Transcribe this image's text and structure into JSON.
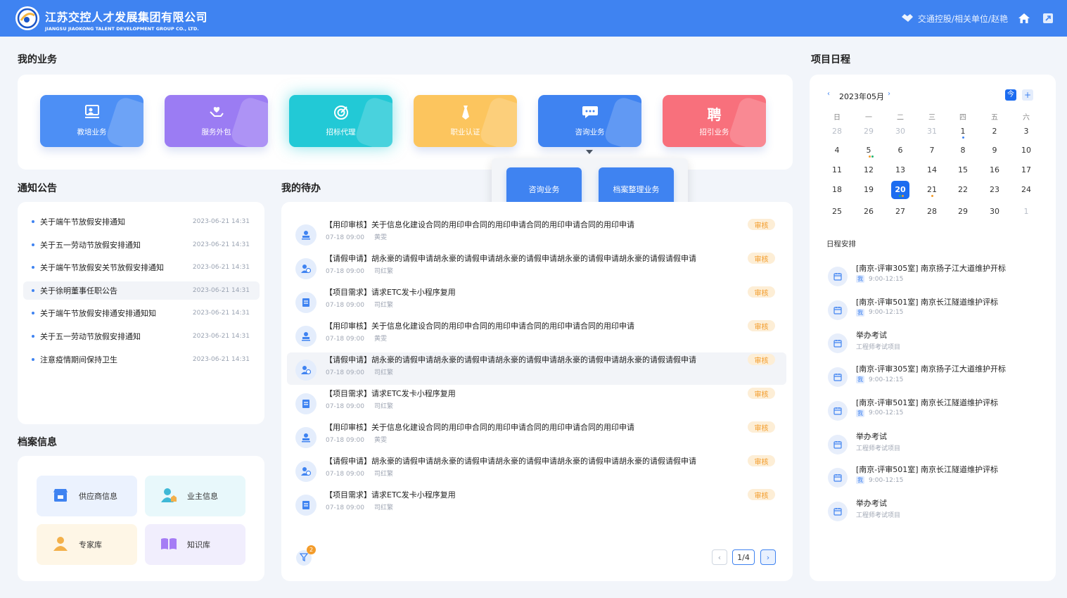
{
  "header": {
    "title_cn": "江苏交控人才发展集团有限公司",
    "title_en": "JIANGSU JIAOKONG TALENT DEVELOPMENT GROUP CO., LTD.",
    "user": "交通控股/相关单位/赵艳"
  },
  "sections": {
    "business": "我的业务",
    "notices": "通知公告",
    "todos": "我的待办",
    "archives": "档案信息",
    "schedule": "项目日程"
  },
  "business": [
    {
      "label": "教培业务",
      "color": "#4d8ff5",
      "icon": "training-icon"
    },
    {
      "label": "服务外包",
      "color": "#9b7cf3",
      "icon": "heart-hand-icon"
    },
    {
      "label": "招标代理",
      "color": "#22c9d6",
      "icon": "target-icon"
    },
    {
      "label": "职业认证",
      "color": "#fcc55e",
      "icon": "tie-icon"
    },
    {
      "label": "咨询业务",
      "color": "#3f83f1",
      "icon": "chat-icon"
    },
    {
      "label": "招引业务",
      "color": "#f8707c",
      "icon": "hire-icon",
      "glyph": "聘"
    }
  ],
  "submenu": [
    "咨询业务",
    "档案整理业务"
  ],
  "notices": [
    {
      "title": "关于端午节放假安排通知",
      "date": "2023-06-21 14:31"
    },
    {
      "title": "关于五一劳动节放假安排通知",
      "date": "2023-06-21 14:31"
    },
    {
      "title": "关于端午节放假安关节放假安排通知",
      "date": "2023-06-21 14:31"
    },
    {
      "title": "关于徐明董事任职公告",
      "date": "2023-06-21 14:31"
    },
    {
      "title": "关于端午节放假安排通安排通知知",
      "date": "2023-06-21 14:31"
    },
    {
      "title": "关于五一劳动节放假安排通知",
      "date": "2023-06-21 14:31"
    },
    {
      "title": "注意疫情期间保持卫生",
      "date": "2023-06-21 14:31"
    }
  ],
  "todos": [
    {
      "title": "【用印审核】关于信息化建设合同的用印申合同的用印申请合同的用印申请合同的用印申请",
      "time": "07-18 09:00",
      "person": "黄雯",
      "badge": "审核",
      "icon": "stamp-icon"
    },
    {
      "title": "【请假申请】胡永豪的请假申请胡永豪的请假申请胡永豪的请假申请胡永豪的请假申请胡永豪的请假请假申请",
      "time": "07-18 09:00",
      "person": "司红繁",
      "badge": "审核",
      "icon": "leave-icon"
    },
    {
      "title": "【项目需求】请求ETC发卡小程序复用",
      "time": "07-18 09:00",
      "person": "司红繁",
      "badge": "审核",
      "icon": "project-icon"
    },
    {
      "title": "【用印审核】关于信息化建设合同的用印申合同的用印申请合同的用印申请合同的用印申请",
      "time": "07-18 09:00",
      "person": "黄雯",
      "badge": "审核",
      "icon": "stamp-icon"
    },
    {
      "title": "【请假申请】胡永豪的请假申请胡永豪的请假申请胡永豪的请假申请胡永豪的请假申请胡永豪的请假请假申请",
      "time": "07-18 09:00",
      "person": "司红繁",
      "badge": "审核",
      "icon": "leave-icon"
    },
    {
      "title": "【项目需求】请求ETC发卡小程序复用",
      "time": "07-18 09:00",
      "person": "司红繁",
      "badge": "审核",
      "icon": "project-icon"
    },
    {
      "title": "【用印审核】关于信息化建设合同的用印申合同的用印申请合同的用印申请合同的用印申请",
      "time": "07-18 09:00",
      "person": "黄雯",
      "badge": "审核",
      "icon": "stamp-icon"
    },
    {
      "title": "【请假申请】胡永豪的请假申请胡永豪的请假申请胡永豪的请假申请胡永豪的请假申请胡永豪的请假请假申请",
      "time": "07-18 09:00",
      "person": "司红繁",
      "badge": "审核",
      "icon": "leave-icon"
    },
    {
      "title": "【项目需求】请求ETC发卡小程序复用",
      "time": "07-18 09:00",
      "person": "司红繁",
      "badge": "审核",
      "icon": "project-icon"
    }
  ],
  "filter_count": "2",
  "pagination": {
    "page": "1/4"
  },
  "archives": [
    {
      "label": "供应商信息",
      "bg": "#ebf2fe",
      "icon": "supplier-icon"
    },
    {
      "label": "业主信息",
      "bg": "#e8f8fb",
      "icon": "owner-icon"
    },
    {
      "label": "专家库",
      "bg": "#fef6e6",
      "icon": "expert-icon"
    },
    {
      "label": "知识库",
      "bg": "#f1eefd",
      "icon": "knowledge-icon"
    }
  ],
  "calendar": {
    "month": "2023年05月",
    "today_btn": "今",
    "add_btn": "+",
    "weekdays": [
      "日",
      "一",
      "二",
      "三",
      "四",
      "五",
      "六"
    ],
    "weeks": [
      [
        "28",
        "29",
        "30",
        "31",
        "1",
        "2",
        "3"
      ],
      [
        "4",
        "5",
        "6",
        "7",
        "8",
        "9",
        "10"
      ],
      [
        "11",
        "12",
        "13",
        "14",
        "15",
        "16",
        "17"
      ],
      [
        "18",
        "19",
        "20",
        "21",
        "22",
        "23",
        "24"
      ],
      [
        "25",
        "26",
        "27",
        "28",
        "29",
        "30",
        "1"
      ]
    ],
    "selected": "20"
  },
  "schedule_label": "日程安排",
  "schedule": [
    {
      "title": "[南京-评审305室] 南京扬子江大道维护开标",
      "tag": "我",
      "sub": "9:00-12:15"
    },
    {
      "title": "[南京-评审501室] 南京长江隧道维护评标",
      "tag": "我",
      "sub": "9:00-12:15"
    },
    {
      "title": "举办考试",
      "tag": "",
      "sub": "工程师考试项目"
    },
    {
      "title": "[南京-评审305室] 南京扬子江大道维护开标",
      "tag": "我",
      "sub": "9:00-12:15"
    },
    {
      "title": "[南京-评审501室] 南京长江隧道维护评标",
      "tag": "我",
      "sub": "9:00-12:15"
    },
    {
      "title": "举办考试",
      "tag": "",
      "sub": "工程师考试项目"
    },
    {
      "title": "[南京-评审501室] 南京长江隧道维护评标",
      "tag": "我",
      "sub": "9:00-12:15"
    },
    {
      "title": "举办考试",
      "tag": "",
      "sub": "工程师考试项目"
    }
  ]
}
